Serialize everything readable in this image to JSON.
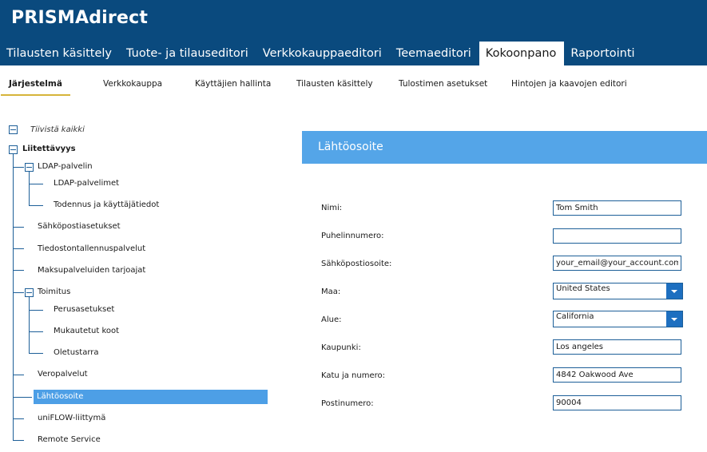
{
  "brand": "PRISMAdirect",
  "main_tabs": [
    {
      "label": "Tilausten käsittely"
    },
    {
      "label": "Tuote- ja tilauseditori"
    },
    {
      "label": "Verkkokauppaeditori"
    },
    {
      "label": "Teemaeditori"
    },
    {
      "label": "Kokoonpano",
      "active": true
    },
    {
      "label": "Raportointi"
    }
  ],
  "sub_tabs": [
    {
      "label": "Järjestelmä",
      "active": true
    },
    {
      "label": "Verkkokauppa"
    },
    {
      "label": "Käyttäjien hallinta"
    },
    {
      "label": "Tilausten käsittely"
    },
    {
      "label": "Tulostimen asetukset"
    },
    {
      "label": "Hintojen ja kaavojen editori"
    }
  ],
  "tree": {
    "collapse_all": "Tiivistä kaikki",
    "root": "Liitettävyys",
    "items": [
      {
        "label": "LDAP-palvelin"
      },
      {
        "label": "LDAP-palvelimet"
      },
      {
        "label": "Todennus ja käyttäjätiedot"
      },
      {
        "label": "Sähköpostiasetukset"
      },
      {
        "label": "Tiedostontallennuspalvelut"
      },
      {
        "label": "Maksupalveluiden tarjoajat"
      },
      {
        "label": "Toimitus"
      },
      {
        "label": "Perusasetukset"
      },
      {
        "label": "Mukautetut koot"
      },
      {
        "label": "Oletustarra"
      },
      {
        "label": "Veropalvelut"
      },
      {
        "label": "Lähtöosoite",
        "selected": true
      },
      {
        "label": "uniFLOW-liittymä"
      },
      {
        "label": "Remote Service"
      }
    ]
  },
  "panel": {
    "title": "Lähtöosoite",
    "fields": {
      "name": {
        "label": "Nimi:",
        "value": "Tom Smith"
      },
      "phone": {
        "label": "Puhelinnumero:",
        "value": ""
      },
      "email": {
        "label": "Sähköpostiosoite:",
        "value": "your_email@your_account.com"
      },
      "country": {
        "label": "Maa:",
        "value": "United States"
      },
      "region": {
        "label": "Alue:",
        "value": "California"
      },
      "city": {
        "label": "Kaupunki:",
        "value": "Los angeles"
      },
      "street": {
        "label": "Katu ja numero:",
        "value": "4842 Oakwood Ave"
      },
      "postal": {
        "label": "Postinumero:",
        "value": "90004"
      }
    }
  },
  "colors": {
    "header": "#0a4a7e",
    "panel_header": "#54a5e8",
    "selection": "#4d9fe6",
    "tree_lines": "#1d5f98",
    "active_underline": "#d6b43a"
  }
}
